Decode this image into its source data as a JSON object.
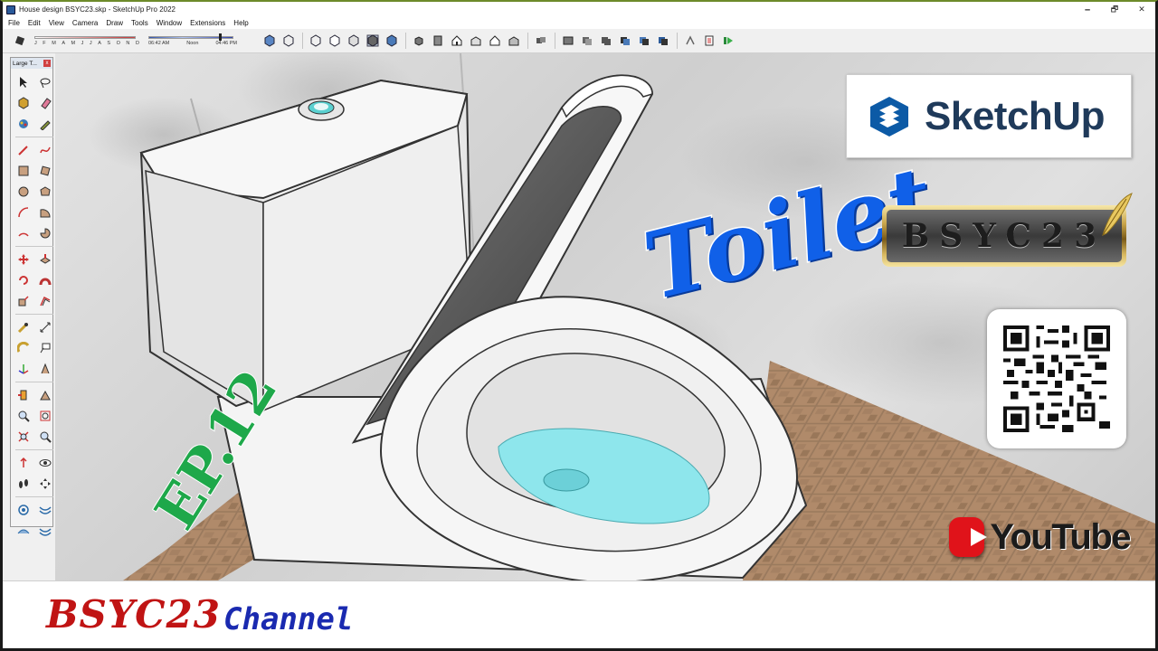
{
  "window": {
    "title": "House design BSYC23.skp - SketchUp Pro 2022",
    "min_glyph": "🗕",
    "max_glyph": "🗗",
    "close_glyph": "✕"
  },
  "menu": [
    "File",
    "Edit",
    "View",
    "Camera",
    "Draw",
    "Tools",
    "Window",
    "Extensions",
    "Help"
  ],
  "shadows": {
    "months": [
      "J",
      "F",
      "M",
      "A",
      "M",
      "J",
      "J",
      "A",
      "S",
      "O",
      "N",
      "D"
    ],
    "time_start": "06:42 AM",
    "time_mid": "Noon",
    "time_end": "04:46 PM"
  },
  "palette": {
    "title": "Large T...",
    "close_glyph": "x"
  },
  "overlay": {
    "sketchup_word": "SketchUp",
    "badge": "BSYC23",
    "title": "Toilet",
    "episode": "EP.12",
    "youtube_word": "YouTube"
  },
  "banner": {
    "brand": "BSYC23",
    "channel": "Channel"
  },
  "colors": {
    "title_blue": "#1060e8",
    "episode_green": "#1ea84a",
    "brand_red": "#c01414",
    "channel_blue": "#1a2ab0",
    "youtube_red": "#e0131a",
    "water": "#8ee6ec"
  }
}
